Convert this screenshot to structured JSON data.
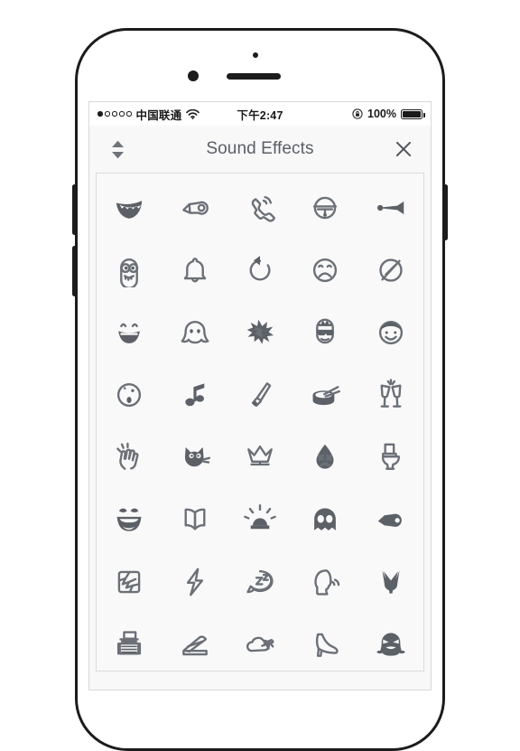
{
  "device": {
    "type": "smartphone-mockup",
    "frame_color": "#1c1c1c",
    "buttons": [
      "volume-up",
      "volume-down",
      "power"
    ]
  },
  "status_bar": {
    "signal_dots_total": 5,
    "signal_dots_filled": 1,
    "carrier": "中国联通",
    "wifi": "wifi-icon",
    "time": "下午2:47",
    "lock_icon": "rotation-lock-icon",
    "battery_percent": "100%",
    "battery_level": 100
  },
  "header": {
    "collapse_label": "collapse-expand-handle",
    "title": "Sound Effects",
    "close_label": "close-icon",
    "title_color": "#5a5f66"
  },
  "grid": {
    "columns": 5,
    "rows": 8,
    "icon_color": "#6b7077",
    "background": "#f9f9f9",
    "items": [
      {
        "name": "laughing-teeth-mouth-icon",
        "row": 1,
        "col": 1
      },
      {
        "name": "whistle-outline-icon",
        "row": 1,
        "col": 2
      },
      {
        "name": "ringing-phone-handset-icon",
        "row": 1,
        "col": 3
      },
      {
        "name": "alarm-doorbell-icon",
        "row": 1,
        "col": 4
      },
      {
        "name": "air-horn-icon",
        "row": 1,
        "col": 5
      },
      {
        "name": "minion-face-icon",
        "row": 2,
        "col": 1
      },
      {
        "name": "bell-icon",
        "row": 2,
        "col": 2
      },
      {
        "name": "rewind-circular-arrow-icon",
        "row": 2,
        "col": 3
      },
      {
        "name": "sad-face-icon",
        "row": 2,
        "col": 4
      },
      {
        "name": "mute-slash-circle-icon",
        "row": 2,
        "col": 5
      },
      {
        "name": "grinning-face-icon",
        "row": 3,
        "col": 1
      },
      {
        "name": "ghost-outline-icon",
        "row": 3,
        "col": 2
      },
      {
        "name": "explosion-crash-icon",
        "row": 3,
        "col": 3
      },
      {
        "name": "cool-sunglasses-face-icon",
        "row": 3,
        "col": 4
      },
      {
        "name": "smiling-boy-face-icon",
        "row": 3,
        "col": 5
      },
      {
        "name": "surprised-face-icon",
        "row": 4,
        "col": 1
      },
      {
        "name": "music-note-icon",
        "row": 4,
        "col": 2
      },
      {
        "name": "sword-icon",
        "row": 4,
        "col": 3
      },
      {
        "name": "snare-drum-icon",
        "row": 4,
        "col": 4
      },
      {
        "name": "toasting-glasses-icon",
        "row": 4,
        "col": 5
      },
      {
        "name": "clapping-hands-icon",
        "row": 5,
        "col": 1
      },
      {
        "name": "cat-face-icon",
        "row": 5,
        "col": 2
      },
      {
        "name": "crown-icon",
        "row": 5,
        "col": 3
      },
      {
        "name": "sad-water-drop-icon",
        "row": 5,
        "col": 4
      },
      {
        "name": "toilet-icon",
        "row": 5,
        "col": 5
      },
      {
        "name": "awesome-face-icon",
        "row": 6,
        "col": 1
      },
      {
        "name": "open-book-icon",
        "row": 6,
        "col": 2
      },
      {
        "name": "siren-light-icon",
        "row": 6,
        "col": 3
      },
      {
        "name": "pacman-ghost-icon",
        "row": 6,
        "col": 4
      },
      {
        "name": "whistle-filled-icon",
        "row": 6,
        "col": 5
      },
      {
        "name": "broken-glass-icon",
        "row": 7,
        "col": 1
      },
      {
        "name": "lightning-bolt-icon",
        "row": 7,
        "col": 2
      },
      {
        "name": "sleep-zzz-bubble-icon",
        "row": 7,
        "col": 3
      },
      {
        "name": "talking-head-icon",
        "row": 7,
        "col": 4
      },
      {
        "name": "tulip-flower-icon",
        "row": 7,
        "col": 5
      },
      {
        "name": "typewriter-icon",
        "row": 8,
        "col": 1
      },
      {
        "name": "stapler-icon",
        "row": 8,
        "col": 2
      },
      {
        "name": "airplane-cloud-icon",
        "row": 8,
        "col": 3
      },
      {
        "name": "high-heel-shoe-icon",
        "row": 8,
        "col": 4
      },
      {
        "name": "angry-ghost-icon",
        "row": 8,
        "col": 5
      }
    ]
  }
}
